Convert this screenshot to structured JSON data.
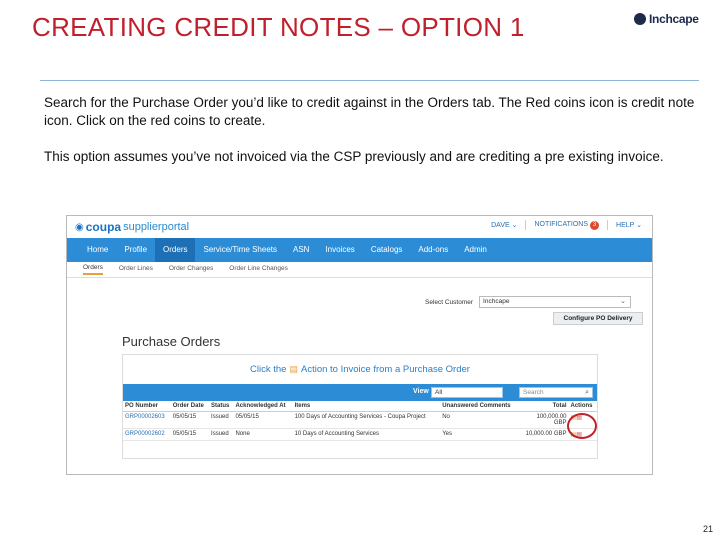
{
  "slide": {
    "title": "CREATING CREDIT NOTES – OPTION 1",
    "logo_text": "Inchcape",
    "paragraph1": "Search for the Purchase Order you’d like to credit against in the Orders tab. The Red coins icon is credit note icon. Click on the red coins to create.",
    "paragraph2": "This option assumes you’ve not invoiced via the CSP previously and are crediting a pre existing invoice.",
    "page_number": "21"
  },
  "portal": {
    "brand": "coupa",
    "brand_suffix": "supplierportal",
    "top_links": {
      "user": "DAVE ⌄",
      "notifications": "NOTIFICATIONS",
      "notifications_count": "3",
      "help": "HELP ⌄"
    },
    "nav": [
      "Home",
      "Profile",
      "Orders",
      "Service/Time Sheets",
      "ASN",
      "Invoices",
      "Catalogs",
      "Add-ons",
      "Admin"
    ],
    "nav_active": "Orders",
    "subnav": [
      "Orders",
      "Order Lines",
      "Order Changes",
      "Order Line Changes"
    ],
    "select_customer_label": "Select Customer",
    "select_customer_value": "Inchcape",
    "configure_button": "Configure PO Delivery",
    "heading": "Purchase Orders",
    "banner_prefix": "Click the",
    "banner_suffix": "Action to Invoice from a Purchase Order",
    "view_label": "View",
    "view_value": "All",
    "search_placeholder": "Search",
    "table": {
      "headers": [
        "PO Number",
        "Order Date",
        "Status",
        "Acknowledged At",
        "Items",
        "Unanswered Comments",
        "Total",
        "Actions"
      ],
      "rows": [
        {
          "po": "GRP00002603",
          "date": "05/05/15",
          "status": "Issued",
          "ack": "05/05/15",
          "items": "100 Days of Accounting Services - Coupa Project",
          "comments": "No",
          "total": "100,000.00",
          "currency": "GBP"
        },
        {
          "po": "GRP00002602",
          "date": "05/05/15",
          "status": "Issued",
          "ack": "None",
          "items": "10 Days of Accounting Services",
          "comments": "Yes",
          "total": "10,000.00 GBP",
          "currency": ""
        }
      ]
    }
  },
  "colors": {
    "title_red": "#c0202c",
    "portal_blue": "#2d8cd6",
    "link_blue": "#2a6fb3",
    "coins_gold": "#e8a03d",
    "coins_red": "#d23a2a"
  }
}
